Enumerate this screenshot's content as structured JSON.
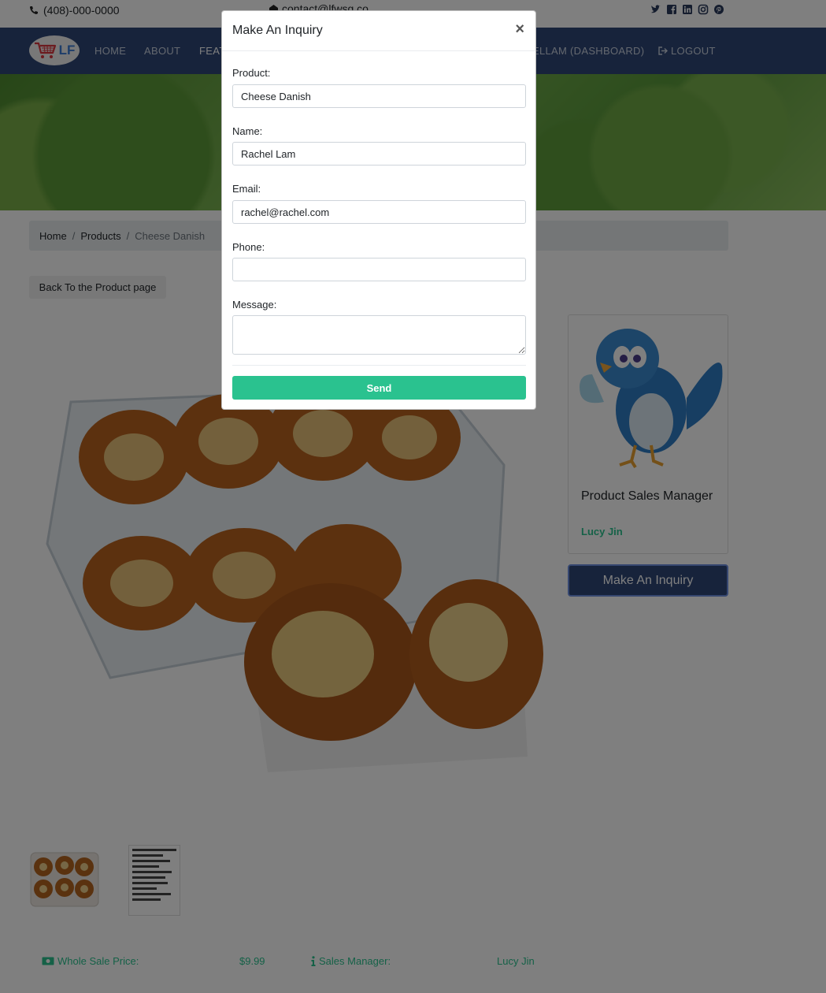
{
  "topbar": {
    "phone": "(408)-000-0000",
    "email": "contact@lfwsg.co",
    "social_icons": [
      "twitter-icon",
      "facebook-icon",
      "linkedin-icon",
      "instagram-icon",
      "pinterest-icon"
    ]
  },
  "nav": {
    "logo_text": "LF",
    "items": [
      "HOME",
      "ABOUT",
      "FEAT",
      "ELLAM (DASHBOARD)",
      "LOGOUT"
    ]
  },
  "breadcrumb": {
    "home": "Home",
    "products": "Products",
    "current": "Cheese Danish"
  },
  "back_button": "Back To the Product page",
  "manager_card": {
    "title": "Product Sales Manager",
    "name": "Lucy Jin"
  },
  "inquiry_button": "Make An Inquiry",
  "info": {
    "price_label": "Whole Sale Price:",
    "price_value": "$9.99",
    "manager_label": "Sales Manager:",
    "manager_value": "Lucy Jin"
  },
  "modal": {
    "title": "Make An Inquiry",
    "close": "×",
    "product_label": "Product:",
    "product_value": "Cheese Danish",
    "name_label": "Name:",
    "name_value": "Rachel Lam",
    "email_label": "Email:",
    "email_value": "rachel@rachel.com",
    "phone_label": "Phone:",
    "phone_value": "",
    "message_label": "Message:",
    "message_value": "",
    "send_label": "Send"
  },
  "colors": {
    "navbar": "#2e4676",
    "accent_green": "#2ac28f"
  }
}
